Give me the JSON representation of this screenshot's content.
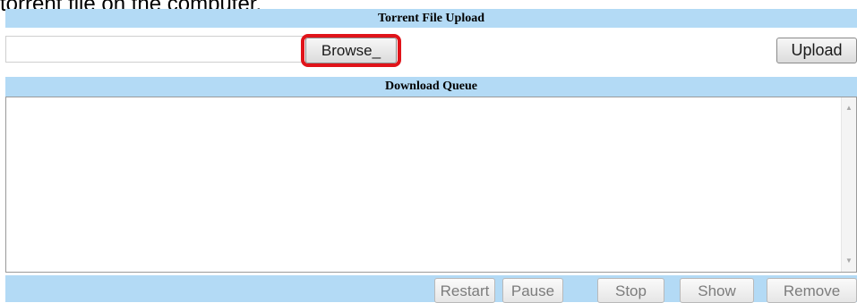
{
  "caption": "torrent file on the computer.",
  "upload_section": {
    "title": "Torrent File Upload",
    "file_value": "",
    "browse_label": "Browse_",
    "upload_label": "Upload"
  },
  "queue_section": {
    "title": "Download Queue",
    "items": []
  },
  "actions": {
    "restart": "Restart",
    "pause": "Pause",
    "stop": "Stop",
    "show": "Show",
    "remove": "Remove"
  },
  "colors": {
    "header_bar": "#b3daf5",
    "highlight_ring": "#e0141a"
  },
  "icons": {
    "scroll_up": "scroll-up-arrow-icon",
    "scroll_down": "scroll-down-arrow-icon"
  }
}
